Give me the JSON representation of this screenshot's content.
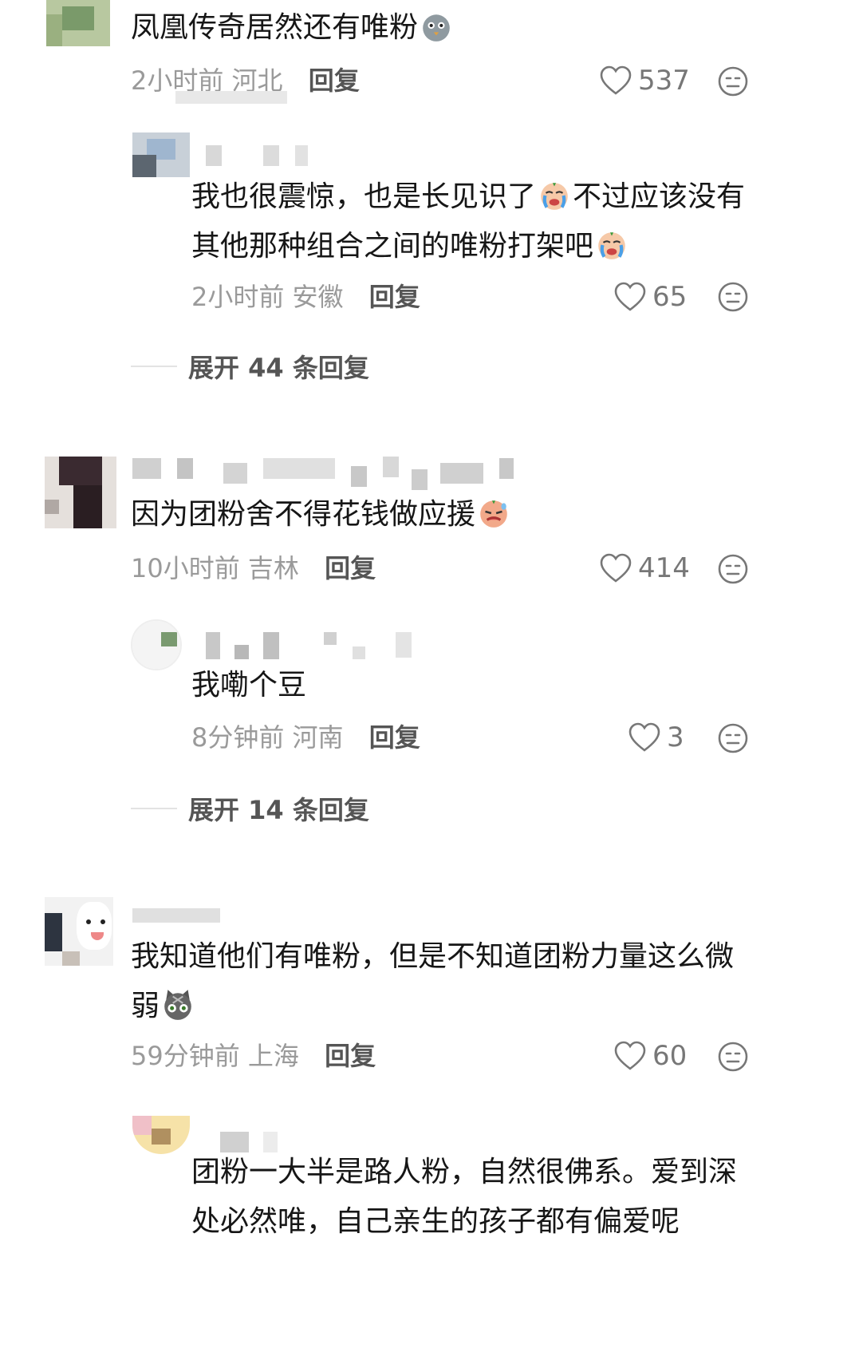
{
  "comments": [
    {
      "text": "凤凰传奇居然还有唯粉",
      "emoji": "pigeon-emoji",
      "time": "2小时前",
      "location": "河北",
      "reply_label": "回复",
      "likes": "537",
      "replies": [
        {
          "text": "我也很震惊，也是长见识了",
          "emoji1": "crying-face-emoji",
          "text2": "不过应该没有其他那种组合之间的唯粉打架吧",
          "emoji2": "crying-face-emoji",
          "time": "2小时前",
          "location": "安徽",
          "reply_label": "回复",
          "likes": "65"
        }
      ],
      "expand_label": "展开 44 条回复"
    },
    {
      "text": "因为团粉舍不得花钱做应援",
      "emoji": "sweat-face-emoji",
      "time": "10小时前",
      "location": "吉林",
      "reply_label": "回复",
      "likes": "414",
      "replies": [
        {
          "text": "我嘞个豆",
          "time": "8分钟前",
          "location": "河南",
          "reply_label": "回复",
          "likes": "3"
        }
      ],
      "expand_label": "展开 14 条回复"
    },
    {
      "text": "我知道他们有唯粉，但是不知道团粉力量这么微",
      "text2": "弱",
      "emoji": "cat-face-emoji",
      "time": "59分钟前",
      "location": "上海",
      "reply_label": "回复",
      "likes": "60",
      "replies": [
        {
          "text": "团粉一大半是路人粉，自然很佛系。爱到深",
          "text2": "处必然唯，自己亲生的孩子都有偏爱呢"
        }
      ]
    }
  ],
  "colors": {
    "text": "#161616",
    "meta": "#9a9a9a",
    "reply": "#555555",
    "icon": "#777777"
  }
}
